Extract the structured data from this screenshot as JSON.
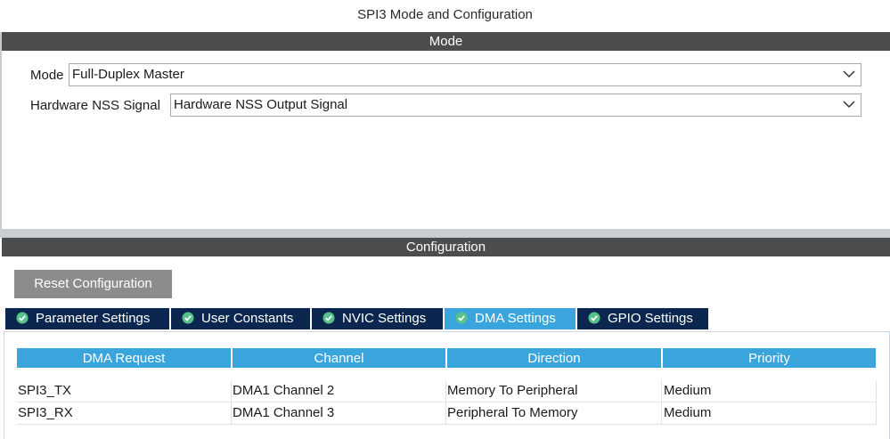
{
  "window": {
    "title": "SPI3 Mode and Configuration"
  },
  "mode_section": {
    "header": "Mode",
    "fields": [
      {
        "label": "Mode",
        "value": "Full-Duplex Master"
      },
      {
        "label": "Hardware NSS Signal",
        "value": "Hardware NSS Output Signal"
      }
    ]
  },
  "config_section": {
    "header": "Configuration",
    "reset_label": "Reset Configuration",
    "tabs": [
      {
        "label": "Parameter Settings",
        "icon": "check-circle-icon",
        "active": false
      },
      {
        "label": "User Constants",
        "icon": "check-circle-icon",
        "active": false
      },
      {
        "label": "NVIC Settings",
        "icon": "check-circle-icon",
        "active": false
      },
      {
        "label": "DMA Settings",
        "icon": "check-circle-icon",
        "active": true
      },
      {
        "label": "GPIO Settings",
        "icon": "check-circle-icon",
        "active": false
      }
    ]
  },
  "dma_table": {
    "columns": [
      "DMA Request",
      "Channel",
      "Direction",
      "Priority"
    ],
    "rows": [
      [
        "SPI3_TX",
        "DMA1 Channel 2",
        "Memory To Peripheral",
        "Medium"
      ],
      [
        "SPI3_RX",
        "DMA1 Channel 3",
        "Peripheral To Memory",
        "Medium"
      ]
    ]
  },
  "colors": {
    "section_bar": "#4d4d4d",
    "tab_inactive": "#0b2750",
    "tab_active": "#39a5dc",
    "table_header": "#39a5dc",
    "reset_button": "#8c8c8c",
    "check_icon": "#56c48a"
  }
}
